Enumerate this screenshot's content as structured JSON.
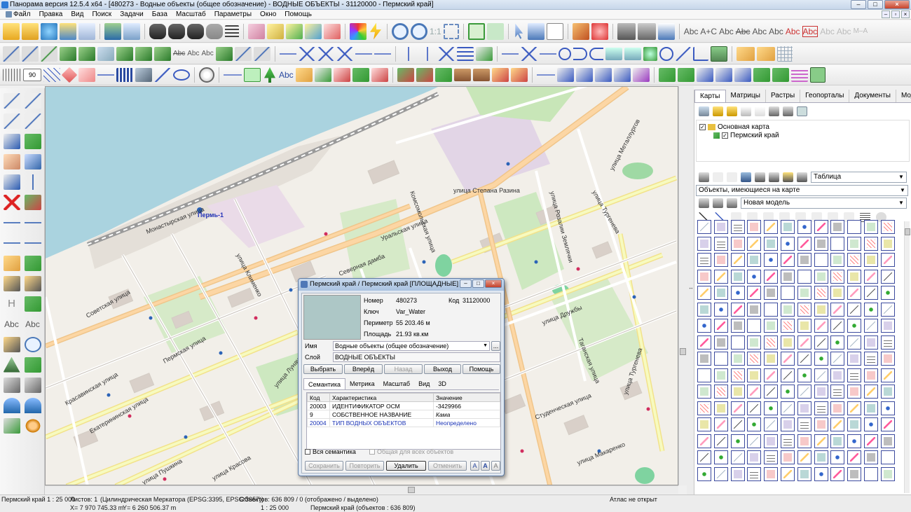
{
  "window": {
    "title": "Панорама версия 12.5.4 x64 - [480273 - Водные объекты (общее обозначение) - ВОДНЫЕ ОБЪЕКТЫ - 31120000 - Пермский край]",
    "minimize": "–",
    "maximize": "□",
    "close": "×"
  },
  "menu": [
    "Файл",
    "Правка",
    "Вид",
    "Поиск",
    "Задачи",
    "База",
    "Масштаб",
    "Параметры",
    "Окно",
    "Помощь"
  ],
  "toolbar": {
    "text_samples": [
      "Abc",
      "A+C",
      "Abc",
      "Abc",
      "Abc",
      "Abc",
      "Abc",
      "Abc",
      "Abc",
      "Abc",
      "M–A"
    ],
    "scale_one_to_one": "1:1",
    "left_abc": "Abc",
    "left_H": "H",
    "left_abc2": "Abc"
  },
  "map": {
    "city_label": "Пермь-1",
    "streets": [
      "улица Металлургов",
      "Монастырская улица",
      "улица Степана Разина",
      "Уральская улица",
      "улица Клименко",
      "улица Розалии Землячки",
      "улица Тургенева",
      "Советская улица",
      "Пермская улица",
      "улица Луначарского",
      "улица Дружбы",
      "Екатерининская улица",
      "улица Пушкина",
      "Студенческая улица",
      "улица Макаренко",
      "Красавинская улица",
      "улица Красова",
      "Комсомольская улица",
      "Таганская улица",
      "улица Тургенева",
      "Северная дамба"
    ]
  },
  "right_panel": {
    "tabs": [
      "Карты",
      "Матрицы",
      "Растры",
      "Геопорталы",
      "Документы",
      "Модели"
    ],
    "tree": [
      {
        "label": "Основная карта",
        "checked": true
      },
      {
        "label": "Пермский край",
        "checked": true
      }
    ],
    "view_combo": "Таблица",
    "objects_combo": "Объекты, имеющиеся на карте",
    "model_combo": "Новая модель"
  },
  "dialog": {
    "title": "Пермский край / Пермский край [ПЛОЩАДНЫЕ]",
    "number_label": "Номер",
    "number_value": "480273",
    "code_label": "Код",
    "code_value": "31120000",
    "key_label": "Ключ",
    "key_value": "Var_Water",
    "perimeter_label": "Периметр",
    "perimeter_value": "55 203.46 м",
    "area_label": "Площадь",
    "area_value": "21.93 кв.км",
    "name_label": "Имя",
    "name_value": "Водные объекты (общее обозначение)",
    "layer_label": "Слой",
    "layer_value": "ВОДНЫЕ ОБЪЕКТЫ",
    "buttons": {
      "select": "Выбрать",
      "forward": "Вперёд",
      "back": "Назад",
      "exit": "Выход",
      "help": "Помощь"
    },
    "tabs": [
      "Семантика",
      "Метрика",
      "Масштаб",
      "Вид",
      "3D"
    ],
    "table": {
      "headers": [
        "Код",
        "Характеристика",
        "Значение"
      ],
      "rows": [
        [
          "20003",
          "ИДЕНТИФИКАТОР ОСМ",
          "-3429966"
        ],
        [
          "9",
          "СОБСТВЕННОЕ НАЗВАНИЕ",
          "Кама"
        ],
        [
          "20004",
          "ТИП ВОДНЫХ ОБЪЕКТОВ",
          "Неопределено"
        ]
      ]
    },
    "all_semantics": "Вся семантика",
    "common_for_all": "Общая для всех объектов",
    "bottom_buttons": {
      "save": "Сохранить",
      "repeat": "Повторить",
      "delete": "Удалить",
      "cancel": "Отменить"
    },
    "font_buttons": [
      "A",
      "A",
      "A"
    ]
  },
  "status": {
    "region_scale": "Пермский край  1 : 25 000",
    "sheets": "Листов: 1",
    "projection": "(Цилиндрическая Меркатора (EPSG:3395, EPSG:3857))",
    "objects": "Объектов: 636 809 / 0 (отображено / выделено)",
    "atlas": "Атлас не открыт",
    "x_coord": "X= 7 970 745.33 m",
    "y_coord": "Y= 6 260 506.37 m",
    "scale2": "1 : 25 000",
    "region_count": "Пермский край   (объектов : 636 809)"
  },
  "colors": {
    "water": "#aad3df",
    "land": "#f2efe9",
    "road_major": "#f9b27c",
    "road_minor": "#ffffff",
    "dialog_border": "#5d7aa3"
  }
}
